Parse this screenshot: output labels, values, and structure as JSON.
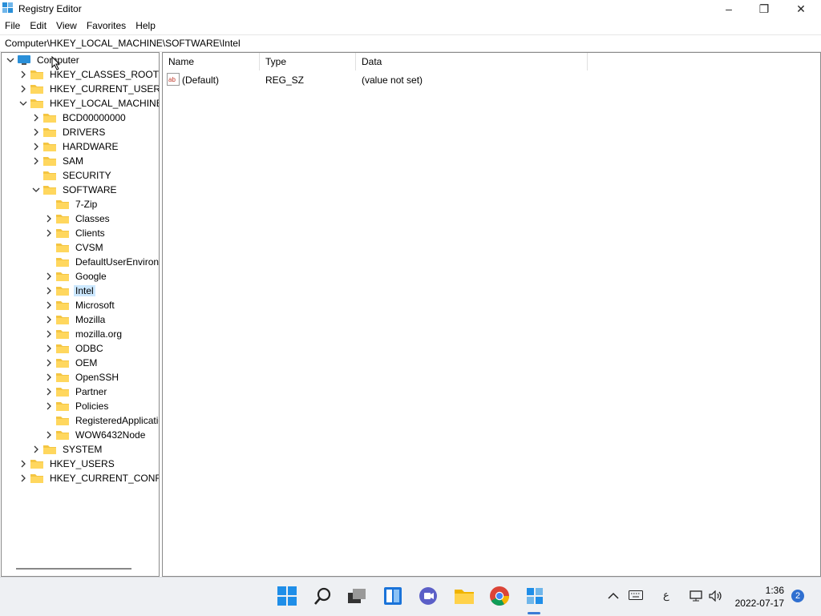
{
  "window": {
    "title": "Registry Editor",
    "controls": {
      "minimize": "–",
      "maximize": "❐",
      "close": "✕"
    }
  },
  "menu": {
    "items": [
      "File",
      "Edit",
      "View",
      "Favorites",
      "Help"
    ]
  },
  "address": {
    "path": "Computer\\HKEY_LOCAL_MACHINE\\SOFTWARE\\Intel"
  },
  "tree": {
    "root": "Computer",
    "nodes": [
      "HKEY_CLASSES_ROOT",
      "HKEY_CURRENT_USER",
      "HKEY_LOCAL_MACHINE",
      "BCD00000000",
      "DRIVERS",
      "HARDWARE",
      "SAM",
      "SECURITY",
      "SOFTWARE",
      "7-Zip",
      "Classes",
      "Clients",
      "CVSM",
      "DefaultUserEnvironm",
      "Google",
      "Intel",
      "Microsoft",
      "Mozilla",
      "mozilla.org",
      "ODBC",
      "OEM",
      "OpenSSH",
      "Partner",
      "Policies",
      "RegisteredApplicatio",
      "WOW6432Node",
      "SYSTEM",
      "HKEY_USERS",
      "HKEY_CURRENT_CONFIG"
    ],
    "selected": "Intel"
  },
  "values": {
    "columns": {
      "name": "Name",
      "type": "Type",
      "data": "Data"
    },
    "rows": [
      {
        "name": "(Default)",
        "type": "REG_SZ",
        "data": "(value not set)"
      }
    ]
  },
  "taskbar": {
    "icons": [
      "windows-start-icon",
      "search-icon",
      "task-view-icon",
      "widgets-icon",
      "chat-icon",
      "file-explorer-icon",
      "chrome-icon",
      "registry-editor-icon"
    ],
    "tray": {
      "language": "ع"
    },
    "clock": {
      "time": "1:36",
      "date": "2022-07-17"
    },
    "notifications": "2"
  }
}
